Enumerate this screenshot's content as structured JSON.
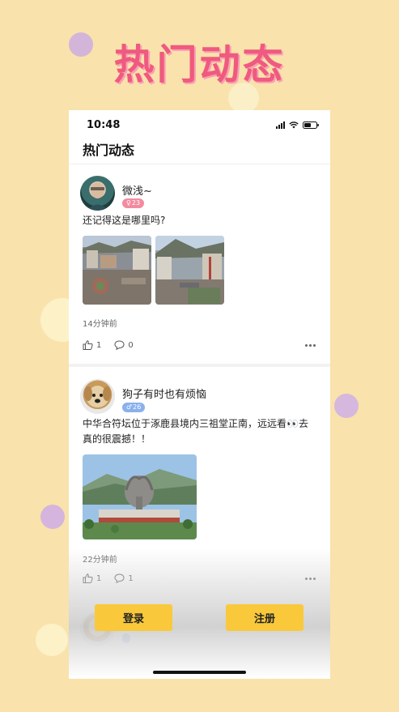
{
  "banner": {
    "title": "热门动态"
  },
  "status_bar": {
    "time": "10:48"
  },
  "header": {
    "title": "热门动态"
  },
  "posts": [
    {
      "user": "微浅~",
      "gender_symbol": "♀",
      "age": "23",
      "text": "还记得这是哪里吗?",
      "time_ago": "14分钟前",
      "likes": "1",
      "comments": "0"
    },
    {
      "user": "狗子有时也有烦恼",
      "gender_symbol": "♂",
      "age": "26",
      "text": "中华合符坛位于涿鹿县境内三祖堂正南，远远看👀去真的很震撼！！",
      "time_ago": "22分钟前",
      "likes": "1",
      "comments": "1"
    }
  ],
  "actions": {
    "login": "登录",
    "register": "注册"
  },
  "colors": {
    "background": "#f9e2ac",
    "banner_title": "#ef5a7e",
    "button": "#f9c93b",
    "female_badge": "#f28ba0",
    "male_badge": "#8ab0ee"
  },
  "icons": [
    "like-icon",
    "comment-icon",
    "more-icon",
    "signal-icon",
    "wifi-icon",
    "battery-icon"
  ]
}
